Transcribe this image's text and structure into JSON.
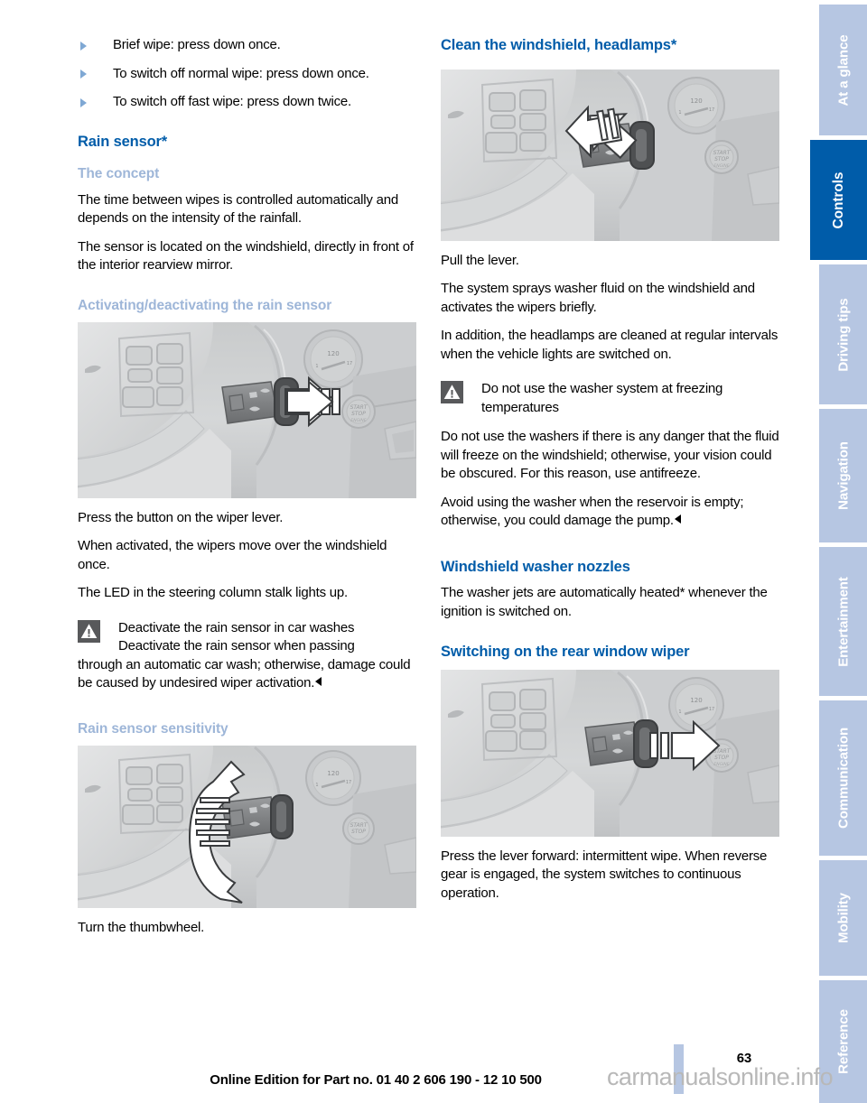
{
  "document": {
    "page_number": "63",
    "footer_line": "Online Edition for Part no. 01 40 2 606 190 - 12 10 500",
    "watermark": "carmanualsonline.info",
    "accent_heading_color": "#005ca9",
    "subheading_color": "#9eb6d8",
    "tab_inactive_color": "#b6c6e2",
    "tab_active_color": "#005ca9"
  },
  "left_column": {
    "bullets": [
      "Brief wipe: press down once.",
      "To switch off normal wipe: press down once.",
      "To switch off fast wipe: press down twice."
    ],
    "heading_rain_sensor": "Rain sensor*",
    "heading_the_concept": "The concept",
    "concept_p1": "The time between wipes is controlled automatically and depends on the intensity of the rainfall.",
    "concept_p2": "The sensor is located on the windshield, directly in front of the interior rearview mirror.",
    "heading_activating": "Activating/deactivating the rain sensor",
    "figure_activating_alt": "Steering wheel with wiper lever, white arrow pointing left at the lever button",
    "after_fig_p1": "Press the button on the wiper lever.",
    "after_fig_p2": "When activated, the wipers move over the windshield once.",
    "after_fig_p3": "The LED in the steering column stalk lights up.",
    "warning": {
      "icon": "warning-triangle-icon",
      "title": "Deactivate the rain sensor in car washes",
      "body_lead": "Deactivate the rain sensor when passing",
      "body_rest": "through an automatic car wash; otherwise, damage could be caused by undesired wiper activation."
    },
    "heading_sensitivity": "Rain sensor sensitivity",
    "figure_sensitivity_alt": "Steering wheel with wiper lever, white double arrow showing thumbwheel rotation up and down",
    "sensitivity_caption": "Turn the thumbwheel."
  },
  "right_column": {
    "heading_clean": "Clean the windshield, headlamps*",
    "figure_clean_alt": "Steering wheel with wiper lever, white arrow pointing left toward the driver",
    "clean_p1": "Pull the lever.",
    "clean_p2": "The system sprays washer fluid on the windshield and activates the wipers briefly.",
    "clean_p3": "In addition, the headlamps are cleaned at regular intervals when the vehicle lights are switched on.",
    "warning": {
      "icon": "warning-triangle-icon",
      "title": "Do not use the washer system at freezing temperatures",
      "body_p1": "Do not use the washers if there is any danger that the fluid will freeze on the windshield; otherwise, your vision could be obscured. For this reason, use antifreeze.",
      "body_p2": "Avoid using the washer when the reservoir is empty; otherwise, you could damage the pump."
    },
    "heading_nozzles": "Windshield washer nozzles",
    "nozzles_p1": "The washer jets are automatically heated* whenever the ignition is switched on.",
    "heading_rear_wiper": "Switching on the rear window wiper",
    "figure_rear_wiper_alt": "Steering wheel with wiper lever, white arrow pointing right toward the start stop button",
    "rear_wiper_caption": "Press the lever forward: intermittent wipe. When reverse gear is engaged, the system switches to continuous operation."
  },
  "tabs": [
    {
      "label": "At a glance",
      "active": false
    },
    {
      "label": "Controls",
      "active": true
    },
    {
      "label": "Driving tips",
      "active": false
    },
    {
      "label": "Navigation",
      "active": false
    },
    {
      "label": "Entertainment",
      "active": false
    },
    {
      "label": "Communication",
      "active": false
    },
    {
      "label": "Mobility",
      "active": false
    },
    {
      "label": "Reference",
      "active": false
    }
  ]
}
